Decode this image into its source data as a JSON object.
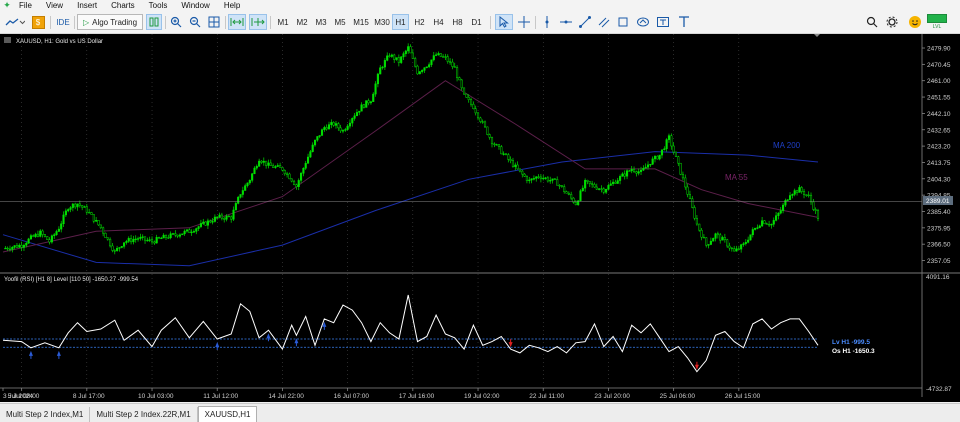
{
  "menu": {
    "items": [
      "File",
      "View",
      "Insert",
      "Charts",
      "Tools",
      "Window",
      "Help"
    ]
  },
  "toolbar": {
    "ide_label": "IDE",
    "algo_label": "Algo Trading",
    "timeframes": [
      "M1",
      "M2",
      "M3",
      "M5",
      "M15",
      "M30",
      "H1",
      "H2",
      "H4",
      "H8",
      "D1"
    ],
    "active_timeframe": "H1",
    "lvl_label": "LVL"
  },
  "chart": {
    "symbol_title": "XAUUSD, H1:  Gold vs US Dollar",
    "ma200_label": "MA 200",
    "ma55_label": "MA 55",
    "price_labels": [
      "2479.90",
      "2470.45",
      "2461.00",
      "2451.55",
      "2442.10",
      "2432.65",
      "2423.20",
      "2413.75",
      "2404.30",
      "2394.85",
      "2389.01",
      "2385.40",
      "2375.95",
      "2366.50",
      "2357.05"
    ],
    "current_price": "2389.01",
    "osc_title": "Yoofil (RSI) [H1 8] Level [110 50] -1650.27 -999.54",
    "osc_top": "4091.16",
    "osc_bottom": "-4732.87",
    "osc_lv": "Lv  H1  -999.5",
    "osc_os": "Os  H1  -1650.3",
    "date_labels": [
      "3 Jul 2024",
      "5 Jul 08:00",
      "8 Jul 17:00",
      "10 Jul 03:00",
      "11 Jul 12:00",
      "14 Jul 22:00",
      "16 Jul 07:00",
      "17 Jul 16:00",
      "19 Jul 02:00",
      "22 Jul 11:00",
      "23 Jul 20:00",
      "25 Jul 06:00",
      "26 Jul 15:00"
    ]
  },
  "chart_data": {
    "type": "candlestick",
    "symbol": "XAUUSD",
    "timeframe": "H1",
    "ylim": [
      2351,
      2488
    ],
    "close_path": [
      [
        0,
        2364
      ],
      [
        4,
        2366
      ],
      [
        6,
        2370
      ],
      [
        8,
        2373
      ],
      [
        10,
        2368
      ],
      [
        12,
        2376
      ],
      [
        14,
        2388
      ],
      [
        16,
        2390
      ],
      [
        18,
        2386
      ],
      [
        21,
        2376
      ],
      [
        24,
        2362
      ],
      [
        26,
        2368
      ],
      [
        29,
        2370
      ],
      [
        32,
        2368
      ],
      [
        34,
        2370
      ],
      [
        37,
        2372
      ],
      [
        40,
        2374
      ],
      [
        43,
        2378
      ],
      [
        46,
        2382
      ],
      [
        49,
        2382
      ],
      [
        51,
        2396
      ],
      [
        53,
        2404
      ],
      [
        55,
        2416
      ],
      [
        57,
        2412
      ],
      [
        60,
        2410
      ],
      [
        62,
        2404
      ],
      [
        63,
        2400
      ],
      [
        65,
        2414
      ],
      [
        67,
        2426
      ],
      [
        69,
        2434
      ],
      [
        71,
        2436
      ],
      [
        73,
        2432
      ],
      [
        75,
        2440
      ],
      [
        77,
        2446
      ],
      [
        79,
        2450
      ],
      [
        81,
        2468
      ],
      [
        83,
        2476
      ],
      [
        85,
        2472
      ],
      [
        87,
        2480
      ],
      [
        89,
        2466
      ],
      [
        91,
        2470
      ],
      [
        93,
        2476
      ],
      [
        95,
        2474
      ],
      [
        97,
        2468
      ],
      [
        99,
        2452
      ],
      [
        101,
        2446
      ],
      [
        103,
        2436
      ],
      [
        105,
        2426
      ],
      [
        107,
        2420
      ],
      [
        109,
        2414
      ],
      [
        111,
        2408
      ],
      [
        113,
        2403
      ],
      [
        115,
        2406
      ],
      [
        117,
        2404
      ],
      [
        119,
        2402
      ],
      [
        121,
        2396
      ],
      [
        123,
        2390
      ],
      [
        125,
        2402
      ],
      [
        127,
        2400
      ],
      [
        129,
        2398
      ],
      [
        131,
        2402
      ],
      [
        133,
        2406
      ],
      [
        135,
        2410
      ],
      [
        137,
        2408
      ],
      [
        139,
        2414
      ],
      [
        141,
        2418
      ],
      [
        143,
        2428
      ],
      [
        145,
        2412
      ],
      [
        147,
        2396
      ],
      [
        149,
        2378
      ],
      [
        151,
        2366
      ],
      [
        153,
        2372
      ],
      [
        155,
        2368
      ],
      [
        157,
        2362
      ],
      [
        159,
        2366
      ],
      [
        161,
        2374
      ],
      [
        163,
        2380
      ],
      [
        165,
        2378
      ],
      [
        167,
        2386
      ],
      [
        169,
        2396
      ],
      [
        171,
        2398
      ],
      [
        173,
        2394
      ],
      [
        175,
        2382
      ]
    ],
    "series": [
      {
        "name": "MA 200",
        "color": "#1a2ea8",
        "values": [
          [
            0,
            2372
          ],
          [
            20,
            2356
          ],
          [
            40,
            2354
          ],
          [
            60,
            2366
          ],
          [
            80,
            2386
          ],
          [
            100,
            2404
          ],
          [
            120,
            2414
          ],
          [
            140,
            2420
          ],
          [
            160,
            2418
          ],
          [
            175,
            2414
          ]
        ]
      },
      {
        "name": "MA 55",
        "color": "#5c1f4a",
        "values": [
          [
            0,
            2362
          ],
          [
            20,
            2374
          ],
          [
            40,
            2376
          ],
          [
            60,
            2394
          ],
          [
            80,
            2432
          ],
          [
            95,
            2461
          ],
          [
            110,
            2436
          ],
          [
            125,
            2410
          ],
          [
            140,
            2410
          ],
          [
            150,
            2398
          ],
          [
            160,
            2390
          ],
          [
            175,
            2382
          ]
        ]
      }
    ],
    "oscillator": {
      "name": "Yoofil (RSI)",
      "ylim": [
        -4732.87,
        4091.16
      ],
      "levels": [
        -999.54,
        -1650.27
      ],
      "values": [
        [
          0,
          -1100
        ],
        [
          4,
          -1200
        ],
        [
          6,
          -1700
        ],
        [
          9,
          -1300
        ],
        [
          12,
          -1700
        ],
        [
          14,
          -500
        ],
        [
          16,
          300
        ],
        [
          18,
          -400
        ],
        [
          21,
          -200
        ],
        [
          24,
          500
        ],
        [
          26,
          -1100
        ],
        [
          29,
          -300
        ],
        [
          32,
          -1600
        ],
        [
          34,
          -300
        ],
        [
          37,
          700
        ],
        [
          40,
          -900
        ],
        [
          43,
          400
        ],
        [
          46,
          -1000
        ],
        [
          49,
          -600
        ],
        [
          51,
          1800
        ],
        [
          53,
          1200
        ],
        [
          55,
          -900
        ],
        [
          57,
          -300
        ],
        [
          60,
          -1800
        ],
        [
          62,
          100
        ],
        [
          63,
          -700
        ],
        [
          65,
          800
        ],
        [
          67,
          -1500
        ],
        [
          69,
          600
        ],
        [
          71,
          300
        ],
        [
          73,
          1700
        ],
        [
          75,
          1300
        ],
        [
          77,
          300
        ],
        [
          79,
          -1200
        ],
        [
          81,
          300
        ],
        [
          83,
          -500
        ],
        [
          85,
          -1000
        ],
        [
          87,
          2500
        ],
        [
          89,
          -1200
        ],
        [
          91,
          -800
        ],
        [
          93,
          900
        ],
        [
          95,
          -600
        ],
        [
          97,
          -900
        ],
        [
          99,
          -1800
        ],
        [
          101,
          100
        ],
        [
          103,
          -1500
        ],
        [
          105,
          -1200
        ],
        [
          107,
          -800
        ],
        [
          109,
          -1800
        ],
        [
          111,
          -2100
        ],
        [
          113,
          -1500
        ],
        [
          115,
          -1700
        ],
        [
          117,
          -2000
        ],
        [
          119,
          -1600
        ],
        [
          121,
          -2100
        ],
        [
          123,
          -1300
        ],
        [
          125,
          -1200
        ],
        [
          127,
          200
        ],
        [
          129,
          -1600
        ],
        [
          131,
          -800
        ],
        [
          133,
          -2000
        ],
        [
          135,
          100
        ],
        [
          137,
          -500
        ],
        [
          139,
          200
        ],
        [
          141,
          -900
        ],
        [
          143,
          -2000
        ],
        [
          145,
          -1600
        ],
        [
          147,
          -2500
        ],
        [
          149,
          -3600
        ],
        [
          151,
          -2700
        ],
        [
          153,
          -700
        ],
        [
          155,
          -400
        ],
        [
          157,
          -1200
        ],
        [
          159,
          -1700
        ],
        [
          161,
          200
        ],
        [
          163,
          600
        ],
        [
          165,
          -200
        ],
        [
          167,
          300
        ],
        [
          169,
          600
        ],
        [
          171,
          600
        ],
        [
          173,
          -400
        ],
        [
          175,
          -1500
        ]
      ]
    },
    "colors": {
      "background": "#000000",
      "candle_body": "#00e000",
      "grid": "#555555",
      "osc_line": "#ffffff",
      "osc_level": "#3b82f6",
      "arrow_buy": "#2a5bd7",
      "arrow_sell": "#e02020"
    }
  },
  "tabs": [
    "Multi Step 2 Index,M1",
    "Multi Step 2 Index.22R,M1",
    "XAUUSD,H1"
  ],
  "active_tab": "XAUUSD,H1"
}
